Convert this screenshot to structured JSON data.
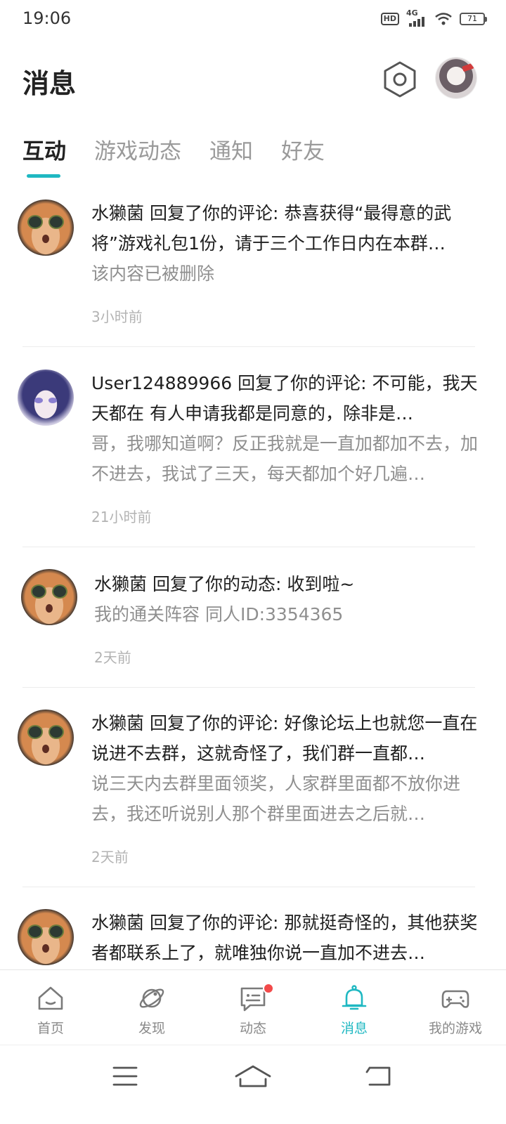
{
  "status_bar": {
    "time": "19:06",
    "hd": "HD",
    "network": "4G",
    "battery": "71"
  },
  "header": {
    "title": "消息"
  },
  "tabs": [
    {
      "label": "互动",
      "active": true
    },
    {
      "label": "游戏动态",
      "active": false
    },
    {
      "label": "通知",
      "active": false
    },
    {
      "label": "好友",
      "active": false
    }
  ],
  "messages": [
    {
      "title": "水獭菌 回复了你的评论: 恭喜获得“最得意的武将”游戏礼包1份，请于三个工作日内在本群…",
      "quote": "该内容已被删除",
      "time": "3小时前",
      "avatar": "cat-avatar"
    },
    {
      "title": "User124889966 回复了你的评论: 不可能，我天天都在 有人申请我都是同意的，除非是…",
      "quote": "哥，我哪知道啊？反正我就是一直加都加不去，加不进去，我试了三天，每天都加个好几遍…",
      "time": "21小时前",
      "avatar": "anime-avatar"
    },
    {
      "title": "水獭菌 回复了你的动态: 收到啦~",
      "quote": "我的通关阵容 同人ID:3354365",
      "time": "2天前",
      "avatar": "cat-avatar"
    },
    {
      "title": "水獭菌 回复了你的评论: 好像论坛上也就您一直在说进不去群，这就奇怪了，我们群一直都…",
      "quote": "说三天内去群里面领奖，人家群里面都不放你进去，我还听说别人那个群里面进去之后就…",
      "time": "2天前",
      "avatar": "cat-avatar"
    },
    {
      "title": "水獭菌 回复了你的评论: 那就挺奇怪的，其他获奖者都联系上了，就唯独你说一直加不进去…",
      "quote": "",
      "time": "",
      "avatar": "cat-avatar"
    }
  ],
  "bottom_nav": [
    {
      "label": "首页",
      "icon": "home-icon",
      "active": false
    },
    {
      "label": "发现",
      "icon": "discover-icon",
      "active": false
    },
    {
      "label": "动态",
      "icon": "feed-icon",
      "active": false,
      "badge": true
    },
    {
      "label": "消息",
      "icon": "bell-icon",
      "active": true
    },
    {
      "label": "我的游戏",
      "icon": "gamepad-icon",
      "active": false
    }
  ],
  "colors": {
    "accent": "#1fb8c2",
    "badge": "#f24a4a",
    "secondary_text": "#8f8f8f"
  }
}
